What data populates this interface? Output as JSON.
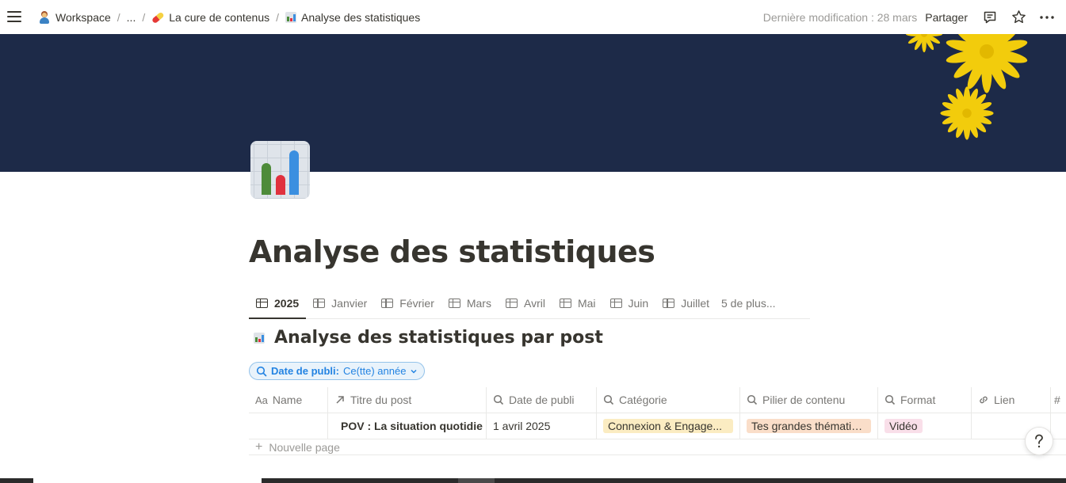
{
  "topbar": {
    "breadcrumbs": [
      {
        "label": "Workspace",
        "icon": "person-emoji-icon"
      },
      {
        "label": "..."
      },
      {
        "label": "La cure de contenus",
        "icon": "pill-emoji-icon"
      },
      {
        "label": "Analyse des statistiques",
        "icon": "bar-chart-emoji-icon"
      }
    ],
    "separator": "/",
    "last_modified": "Dernière modification : 28 mars",
    "share_label": "Partager"
  },
  "colors": {
    "cover": "#1d2a48",
    "flower": "#f2cc0c",
    "accent": "#2383e2",
    "text": "#37352f",
    "muted": "#787774"
  },
  "page": {
    "title": "Analyse des statistiques"
  },
  "tabs": {
    "items": [
      {
        "label": "2025",
        "active": true
      },
      {
        "label": "Janvier"
      },
      {
        "label": "Février"
      },
      {
        "label": "Mars"
      },
      {
        "label": "Avril"
      },
      {
        "label": "Mai"
      },
      {
        "label": "Juin"
      },
      {
        "label": "Juillet"
      }
    ],
    "more_label": "5 de plus..."
  },
  "database": {
    "title": "Analyse des statistiques par post",
    "filter": {
      "property": "Date de publi:",
      "value": "Ce(tte) année"
    },
    "columns": [
      {
        "label": "Name",
        "icon": "Aa"
      },
      {
        "label": "Titre du post",
        "icon": "relation-arrow-icon"
      },
      {
        "label": "Date de publi",
        "icon": "search-icon"
      },
      {
        "label": "Catégorie",
        "icon": "search-icon"
      },
      {
        "label": "Pilier de contenu",
        "icon": "search-icon"
      },
      {
        "label": "Format",
        "icon": "search-icon"
      },
      {
        "label": "Lien",
        "icon": "link-icon"
      },
      {
        "label": "",
        "icon": "hash-icon"
      }
    ],
    "rows": [
      {
        "name": "",
        "titre": "POV : La situation quotidie",
        "date": "1 avril 2025",
        "categorie": "Connexion & Engage...",
        "pilier": "Tes grandes thématiq...",
        "format": "Vidéo",
        "lien": ""
      }
    ],
    "new_row_label": "Nouvelle page",
    "tag_colors": {
      "categorie": "#fbecc2",
      "pilier": "#fadec9",
      "format": "#f9dfe9"
    }
  },
  "help_button_label": "?"
}
